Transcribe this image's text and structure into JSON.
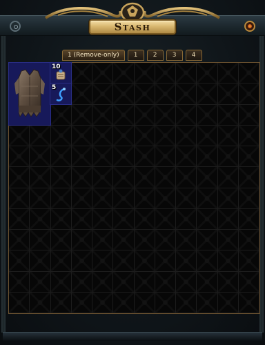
{
  "window": {
    "title": "Stash"
  },
  "tabs": [
    {
      "label": "1 (Remove-only)",
      "active": true
    },
    {
      "label": "1",
      "active": false
    },
    {
      "label": "2",
      "active": false
    },
    {
      "label": "3",
      "active": false
    },
    {
      "label": "4",
      "active": false
    }
  ],
  "grid": {
    "columns": 12,
    "rows": 12
  },
  "items": [
    {
      "name": "leather-body-armour-icon",
      "quantity": ""
    },
    {
      "name": "portal-scroll-icon",
      "quantity": "10"
    },
    {
      "name": "blue-orb-stack-icon",
      "quantity": "5"
    }
  ],
  "colors": {
    "accent_gold": "#d9b870",
    "item_highlight": "#17195a",
    "close_button": "#ff9a3a"
  }
}
